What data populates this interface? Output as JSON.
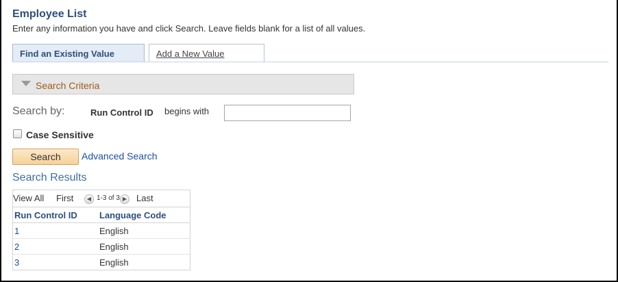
{
  "page": {
    "title": "Employee List",
    "instructions": "Enter any information you have and click Search. Leave fields blank for a list of all values."
  },
  "tabs": [
    {
      "label": "Find an Existing Value",
      "active": true
    },
    {
      "label": "Add a New Value",
      "active": false
    }
  ],
  "criteria": {
    "label": "Search Criteria"
  },
  "search_by": {
    "label": "Search by:",
    "field": "Run Control ID",
    "operator": "begins with",
    "value": ""
  },
  "case_sensitive": {
    "label": "Case Sensitive",
    "checked": false
  },
  "buttons": {
    "search": "Search",
    "advanced": "Advanced Search"
  },
  "results": {
    "title": "Search Results",
    "nav": {
      "view_all": "View All",
      "first": "First",
      "range": "1-3 of 3",
      "last": "Last"
    },
    "columns": [
      "Run Control ID",
      "Language Code"
    ],
    "rows": [
      {
        "id": "1",
        "lang": "English"
      },
      {
        "id": "2",
        "lang": "English"
      },
      {
        "id": "3",
        "lang": "English"
      }
    ]
  },
  "colors": {
    "title": "#2d4f7c",
    "link": "#1b4f9c",
    "criteria_label": "#a05a1c",
    "search_button": "#f7d197"
  }
}
